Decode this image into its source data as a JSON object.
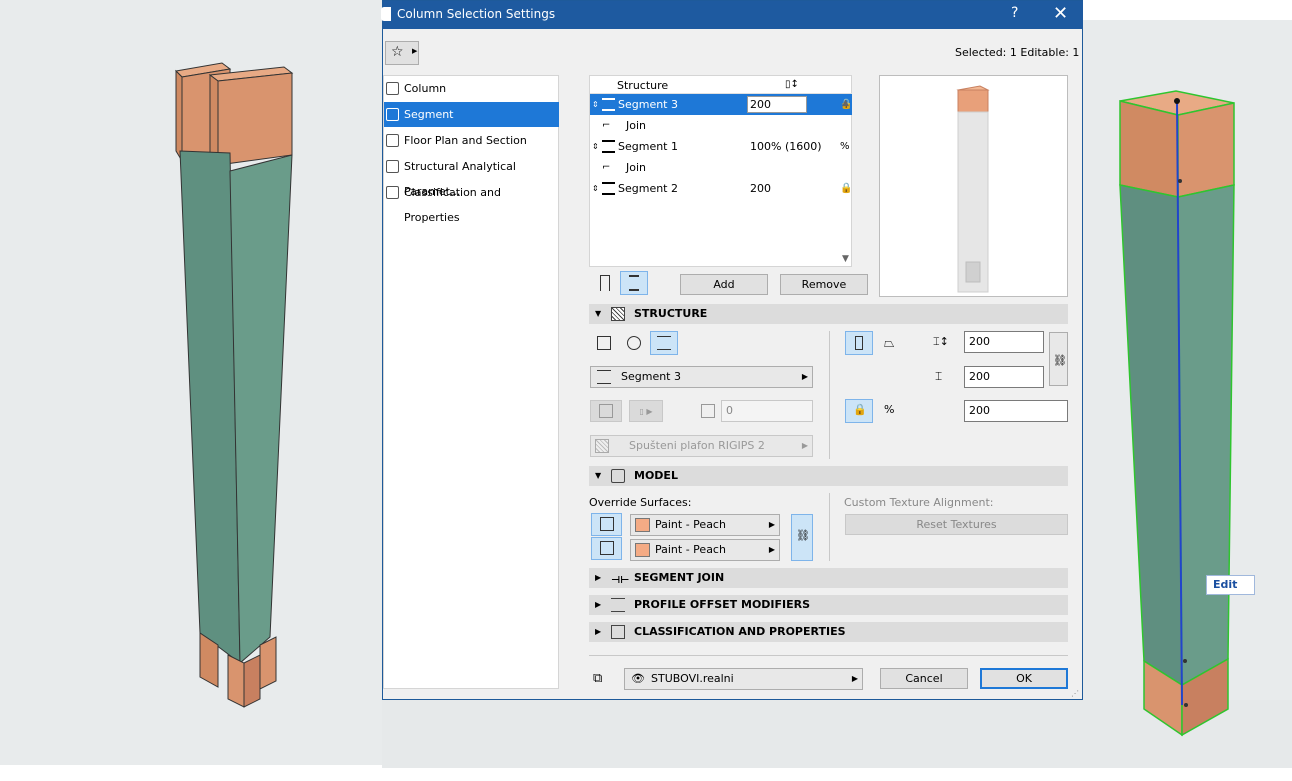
{
  "dialog": {
    "title": "Column Selection Settings",
    "help_label": "?",
    "close_label": "✕",
    "selected_info": "Selected: 1 Editable: 1"
  },
  "nav": {
    "items": [
      {
        "label": "Column",
        "icon": "column-icon"
      },
      {
        "label": "Segment",
        "icon": "segment-icon",
        "active": true
      },
      {
        "label": "Floor Plan and Section",
        "icon": "floor-plan-icon"
      },
      {
        "label": "Structural Analytical Paramet...",
        "icon": "structural-analytical-icon"
      },
      {
        "label": "Classification and Properties",
        "icon": "classification-icon"
      }
    ]
  },
  "segments": {
    "header": "Structure",
    "rows": [
      {
        "type": "segment",
        "name": "Segment 3",
        "value": "200",
        "selected": true
      },
      {
        "type": "join",
        "name": "Join"
      },
      {
        "type": "segment",
        "name": "Segment 1",
        "value": "100% (1600)"
      },
      {
        "type": "join",
        "name": "Join"
      },
      {
        "type": "segment",
        "name": "Segment 2",
        "value": "200"
      }
    ],
    "add_label": "Add",
    "remove_label": "Remove"
  },
  "structure": {
    "title": "STRUCTURE",
    "profile_name": "Segment 3",
    "disabled_value": "0",
    "material_name": "Spušteni plafon RIGIPS 2",
    "width": "200",
    "depth": "200",
    "length": "200"
  },
  "model": {
    "title": "MODEL",
    "override_label": "Override Surfaces:",
    "surface_top": "Paint - Peach",
    "surface_bottom": "Paint - Peach",
    "texture_label": "Custom Texture Alignment:",
    "reset_label": "Reset Textures"
  },
  "panels": {
    "segment_join": "SEGMENT JOIN",
    "profile_offset": "PROFILE OFFSET MODIFIERS",
    "classification": "CLASSIFICATION AND PROPERTIES"
  },
  "footer": {
    "layer_name": "STUBOVI.realni",
    "cancel_label": "Cancel",
    "ok_label": "OK"
  },
  "viewport": {
    "edit_label": "Edit"
  },
  "colors": {
    "accent": "#1e78d7",
    "column_green": "#6a9c8a",
    "column_peach": "#d9946e",
    "titlebar": "#1e5aa0"
  }
}
